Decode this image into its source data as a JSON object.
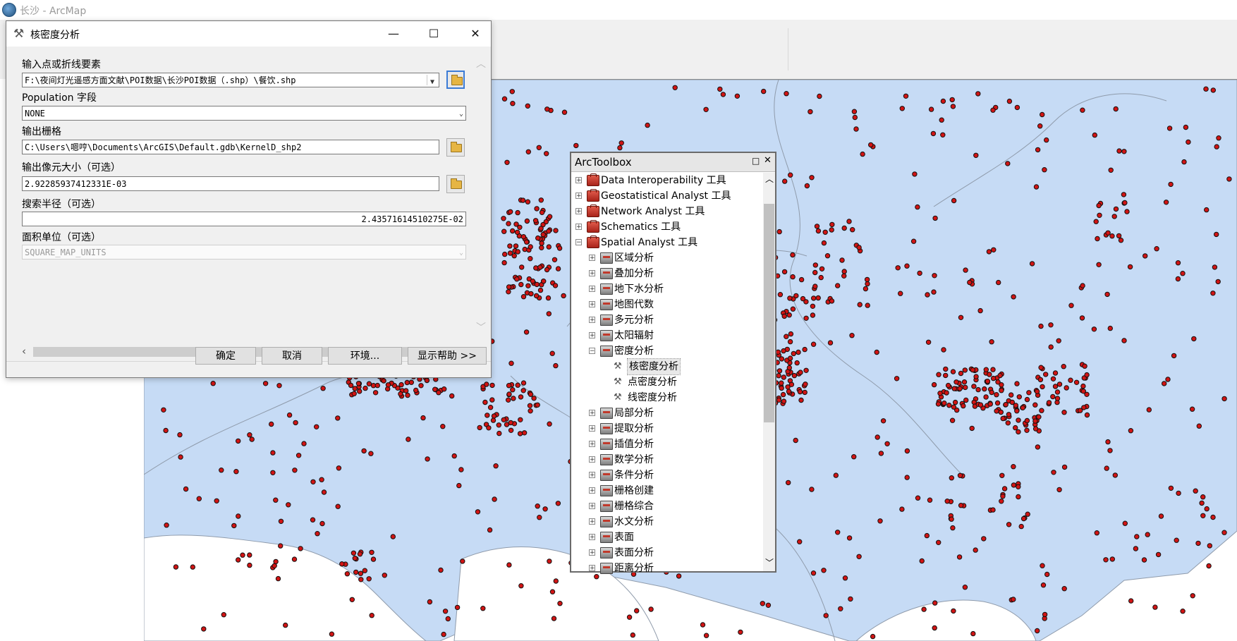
{
  "app": {
    "title": "长沙 - ArcMap"
  },
  "dialog": {
    "title": "核密度分析",
    "input_label": "输入点或折线要素",
    "input_value": "F:\\夜间灯光遥感方面文献\\POI数据\\长沙POI数据（.shp）\\餐饮.shp",
    "population_label": "Population 字段",
    "population_value": "NONE",
    "output_label": "输出栅格",
    "output_value": "C:\\Users\\嗯哼\\Documents\\ArcGIS\\Default.gdb\\KernelD_shp2",
    "cell_label": "输出像元大小（可选）",
    "cell_value": "2.92285937412331E-03",
    "radius_label": "搜索半径（可选）",
    "radius_value": "2.43571614510275E-02",
    "area_label": "面积单位（可选）",
    "area_value": "SQUARE_MAP_UNITS",
    "buttons": {
      "ok": "确定",
      "cancel": "取消",
      "env": "环境...",
      "help": "显示帮助 >>"
    }
  },
  "toolbox": {
    "title": "ArcToolbox",
    "items": [
      {
        "label": "Data Interoperability 工具",
        "level": 0,
        "icon": "toolbox-icon",
        "expander": "+"
      },
      {
        "label": "Geostatistical Analyst 工具",
        "level": 0,
        "icon": "toolbox-icon",
        "expander": "+"
      },
      {
        "label": "Network Analyst 工具",
        "level": 0,
        "icon": "toolbox-icon",
        "expander": "+"
      },
      {
        "label": "Schematics 工具",
        "level": 0,
        "icon": "toolbox-icon",
        "expander": "+"
      },
      {
        "label": "Spatial Analyst 工具",
        "level": 0,
        "icon": "toolbox-icon",
        "expander": "−"
      },
      {
        "label": "区域分析",
        "level": 1,
        "icon": "toolset-icon",
        "expander": "+"
      },
      {
        "label": "叠加分析",
        "level": 1,
        "icon": "toolset-icon",
        "expander": "+"
      },
      {
        "label": "地下水分析",
        "level": 1,
        "icon": "toolset-icon",
        "expander": "+"
      },
      {
        "label": "地图代数",
        "level": 1,
        "icon": "toolset-icon",
        "expander": "+"
      },
      {
        "label": "多元分析",
        "level": 1,
        "icon": "toolset-icon",
        "expander": "+"
      },
      {
        "label": "太阳辐射",
        "level": 1,
        "icon": "toolset-icon",
        "expander": "+"
      },
      {
        "label": "密度分析",
        "level": 1,
        "icon": "toolset-icon",
        "expander": "−"
      },
      {
        "label": "核密度分析",
        "level": 2,
        "icon": "hammer-icon",
        "expander": "",
        "selected": true
      },
      {
        "label": "点密度分析",
        "level": 2,
        "icon": "hammer-icon",
        "expander": ""
      },
      {
        "label": "线密度分析",
        "level": 2,
        "icon": "hammer-icon",
        "expander": ""
      },
      {
        "label": "局部分析",
        "level": 1,
        "icon": "toolset-icon",
        "expander": "+"
      },
      {
        "label": "提取分析",
        "level": 1,
        "icon": "toolset-icon",
        "expander": "+"
      },
      {
        "label": "插值分析",
        "level": 1,
        "icon": "toolset-icon",
        "expander": "+"
      },
      {
        "label": "数学分析",
        "level": 1,
        "icon": "toolset-icon",
        "expander": "+"
      },
      {
        "label": "条件分析",
        "level": 1,
        "icon": "toolset-icon",
        "expander": "+"
      },
      {
        "label": "栅格创建",
        "level": 1,
        "icon": "toolset-icon",
        "expander": "+"
      },
      {
        "label": "栅格综合",
        "level": 1,
        "icon": "toolset-icon",
        "expander": "+"
      },
      {
        "label": "水文分析",
        "level": 1,
        "icon": "toolset-icon",
        "expander": "+"
      },
      {
        "label": "表面",
        "level": 1,
        "icon": "toolset-icon",
        "expander": "+"
      },
      {
        "label": "表面分析",
        "level": 1,
        "icon": "toolset-icon",
        "expander": "+"
      },
      {
        "label": "距离分析",
        "level": 1,
        "icon": "toolset-icon",
        "expander": "+"
      }
    ]
  },
  "colors": {
    "map_fill": "#c6dbf5",
    "map_line": "#8f9bab",
    "poi_fill": "#d11414",
    "poi_stroke": "#111111"
  }
}
